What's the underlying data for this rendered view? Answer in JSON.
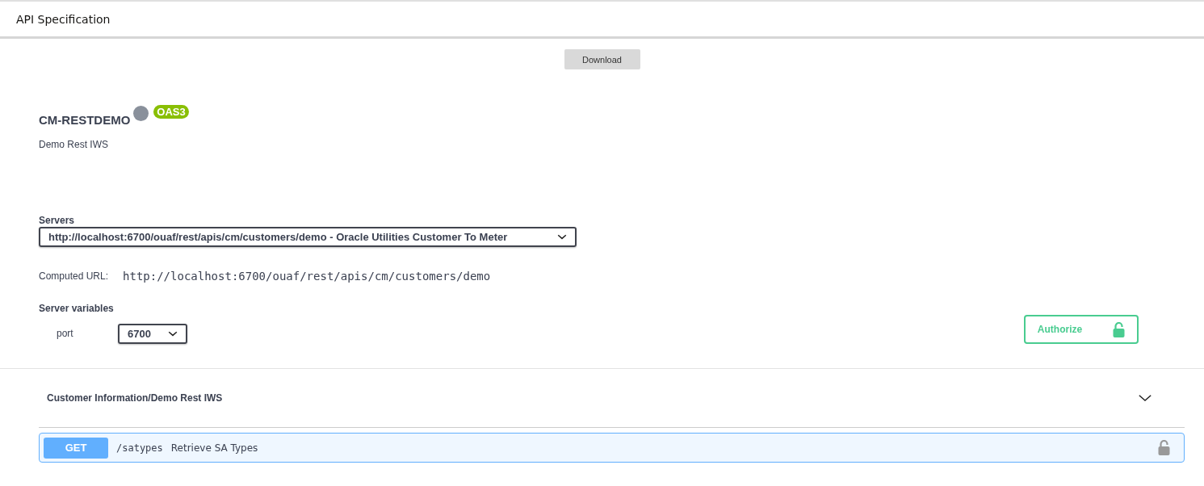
{
  "header": {
    "title": "API Specification"
  },
  "download_button": "Download",
  "info": {
    "title": "CM-RESTDEMO",
    "version_badge": "OAS3",
    "description": "Demo Rest IWS"
  },
  "servers": {
    "label": "Servers",
    "selected_server": "http://localhost:6700/ouaf/rest/apis/cm/customers/demo - Oracle Utilities Customer To Meter",
    "computed_url_label": "Computed URL:",
    "computed_url": "http://localhost:6700/ouaf/rest/apis/cm/customers/demo",
    "variables_label": "Server variables",
    "variables": [
      {
        "name": "port",
        "value": "6700"
      }
    ]
  },
  "authorize_button": "Authorize",
  "tags": [
    {
      "name": "Customer Information/Demo Rest IWS",
      "expanded": true,
      "operations": [
        {
          "method": "GET",
          "path": "/satypes",
          "summary": "Retrieve SA Types"
        }
      ]
    }
  ]
}
